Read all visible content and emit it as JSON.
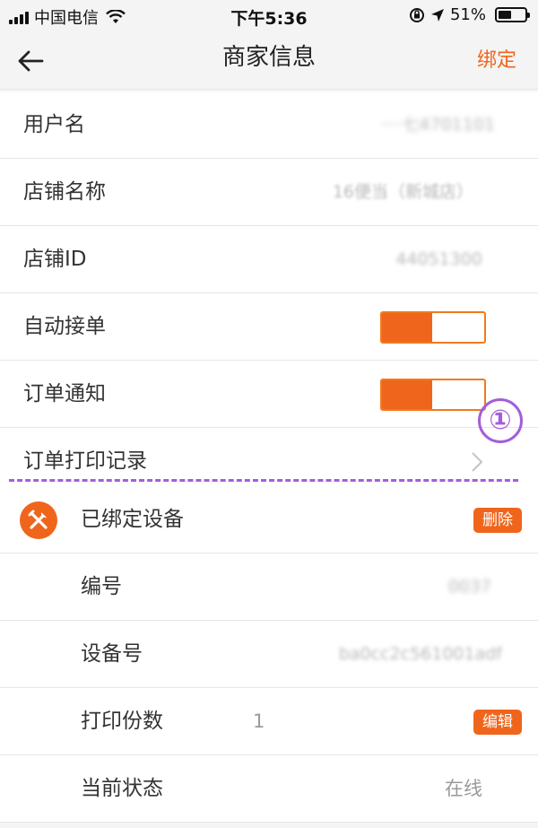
{
  "status_bar": {
    "carrier": "中国电信",
    "time": "下午5:36",
    "battery_percent": "51%",
    "battery_level": 0.51
  },
  "nav": {
    "title": "商家信息",
    "bind_label": "绑定"
  },
  "info_rows": {
    "username": {
      "label": "用户名",
      "value": "····七4701101"
    },
    "store_name": {
      "label": "店铺名称",
      "value": "16便当（新城店）"
    },
    "store_id": {
      "label": "店铺ID",
      "value": "44051300"
    },
    "auto_accept": {
      "label": "自动接单",
      "enabled": true
    },
    "order_notify": {
      "label": "订单通知",
      "enabled": true
    },
    "print_records": {
      "label": "订单打印记录"
    }
  },
  "annotation": {
    "step": "①",
    "accent": "#a45ed9"
  },
  "device": {
    "header": "已绑定设备",
    "delete_label": "删除",
    "number": {
      "label": "编号",
      "value": "0037"
    },
    "device_no": {
      "label": "设备号",
      "value": "ba0cc2c561001adf"
    },
    "copies": {
      "label": "打印份数",
      "value": "1",
      "edit_label": "编辑"
    },
    "current_status": {
      "label": "当前状态",
      "value": "在线"
    }
  },
  "colors": {
    "brand": "#f0651c",
    "background": "#f4f4f4"
  }
}
